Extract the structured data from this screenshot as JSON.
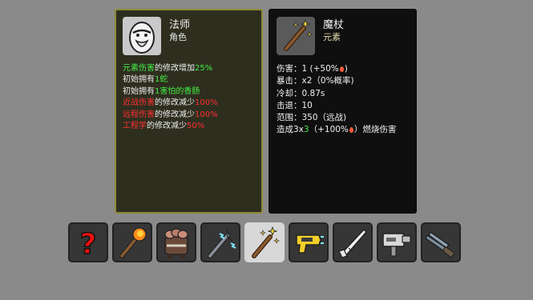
{
  "character": {
    "name": "法师",
    "subtitle": "角色",
    "icon": "egg-mage-portrait",
    "effects": [
      {
        "parts": [
          {
            "text": "元素伤害",
            "color": "green"
          },
          {
            "text": "的修改增加",
            "color": "white"
          },
          {
            "text": "25%",
            "color": "green"
          }
        ]
      },
      {
        "parts": [
          {
            "text": "初始拥有",
            "color": "white"
          },
          {
            "text": "1蛇",
            "color": "green"
          }
        ]
      },
      {
        "parts": [
          {
            "text": "初始拥有",
            "color": "white"
          },
          {
            "text": "1害怕的香肠",
            "color": "green"
          }
        ]
      },
      {
        "parts": [
          {
            "text": "近战伤害",
            "color": "red"
          },
          {
            "text": "的修改减少",
            "color": "white"
          },
          {
            "text": "100%",
            "color": "red"
          }
        ]
      },
      {
        "parts": [
          {
            "text": "远程伤害",
            "color": "red"
          },
          {
            "text": "的修改减少",
            "color": "white"
          },
          {
            "text": "100%",
            "color": "red"
          }
        ]
      },
      {
        "parts": [
          {
            "text": "工程学",
            "color": "red"
          },
          {
            "text": "的修改减少",
            "color": "white"
          },
          {
            "text": "50%",
            "color": "red"
          }
        ]
      }
    ]
  },
  "weapon": {
    "name": "魔杖",
    "subtitle": "元素",
    "icon": "magic-wand-portrait",
    "stats": {
      "damage_label": "伤害：",
      "damage_value": "1 (+50%",
      "damage_close": ")",
      "crit_label": "暴击：",
      "crit_value": "x2（0%概率)",
      "cooldown_label": "冷却：",
      "cooldown_value": "0.87s",
      "knockback_label": "击退：",
      "knockback_value": "10",
      "range_label": "范围：",
      "range_value": "350（远战)",
      "burn_prefix": "造成3x",
      "burn_count": "3",
      "burn_mid": "（+100%",
      "burn_suffix": "）燃烧伤害"
    }
  },
  "slots": [
    {
      "icon": "question-mark-icon",
      "selected": false
    },
    {
      "icon": "torch-icon",
      "selected": false
    },
    {
      "icon": "sausage-bundle-icon",
      "selected": false
    },
    {
      "icon": "lightning-staff-icon",
      "selected": false
    },
    {
      "icon": "magic-wand-icon",
      "selected": true
    },
    {
      "icon": "taser-icon",
      "selected": false
    },
    {
      "icon": "rifle-icon",
      "selected": false
    },
    {
      "icon": "turret-gun-icon",
      "selected": false
    },
    {
      "icon": "double-barrel-icon",
      "selected": false
    }
  ],
  "colors": {
    "good": "#43ee44",
    "bad": "#ff3030",
    "char_panel_bg": "#2e2e1f",
    "char_panel_border": "#8e8a35",
    "weapon_panel_bg": "#0f0f0f",
    "slot_bg": "#363636",
    "slot_selected_bg": "#d8d8d8"
  }
}
